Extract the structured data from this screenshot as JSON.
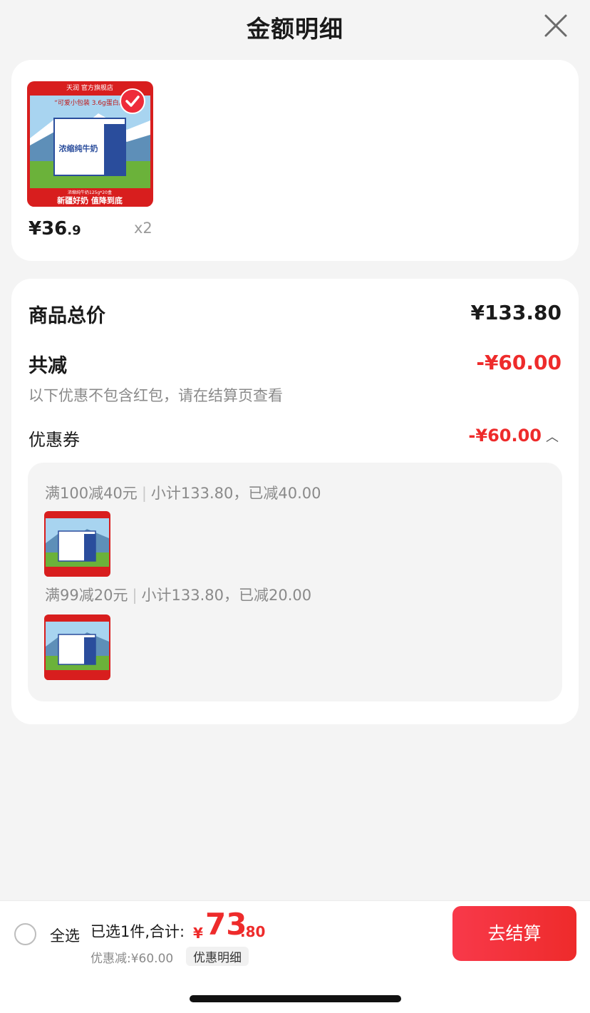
{
  "header": {
    "title": "金额明细"
  },
  "product": {
    "price_main": "¥36",
    "price_cents": ".9",
    "quantity": "x2",
    "image_store": "天润 官方旗舰店",
    "image_tagline": "“可爱小包装 3.6g蛋白质",
    "image_name": "浓缩纯牛奶",
    "image_spec": "浓缩纯牛奶125g*20盒",
    "image_slogan": "新疆好奶 值降到底"
  },
  "breakdown": {
    "subtotal_label": "商品总价",
    "subtotal_value": "¥133.80",
    "reduce_label": "共减",
    "reduce_value": "-¥60.00",
    "hint": "以下优惠不包含红包，请在结算页查看",
    "coupon_label": "优惠券",
    "coupon_value": "-¥60.00",
    "coupons": [
      {
        "rule": "满100减40元",
        "detail": "小计133.80，已减40.00"
      },
      {
        "rule": "满99减20元",
        "detail": "小计133.80，已减20.00"
      }
    ]
  },
  "bottom_bar": {
    "select_all": "全选",
    "summary": "已选1件,合计:",
    "currency": "¥",
    "total_int": "73",
    "total_dec": ".80",
    "discount_note": "优惠减:¥60.00",
    "detail_tag": "优惠明细",
    "checkout": "去结算"
  },
  "colors": {
    "accent": "#ee2b2b",
    "background": "#f4f4f4"
  }
}
